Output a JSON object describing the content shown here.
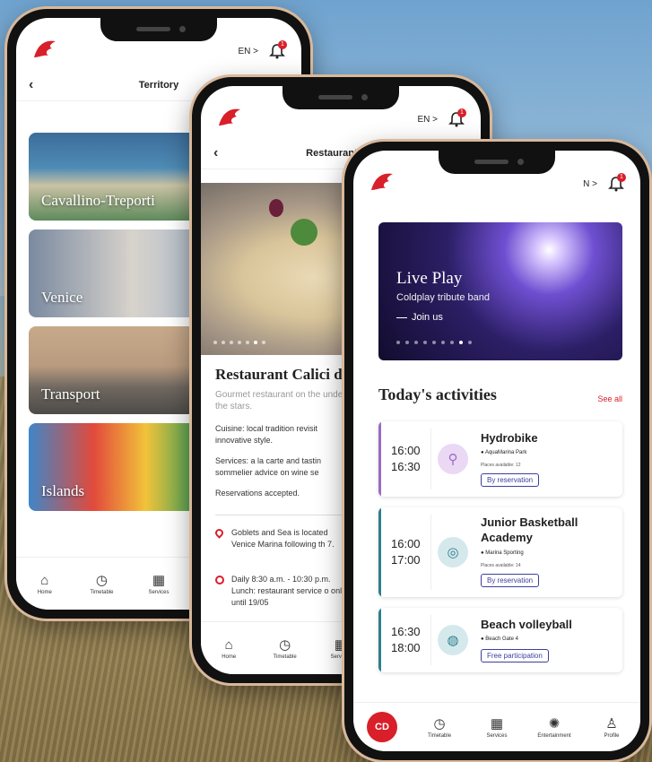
{
  "colors": {
    "brand_red": "#d81f2a",
    "accent_purple": "#9b6bc4",
    "accent_teal": "#2e7f8c",
    "pill_blue": "#3b3f9e"
  },
  "common": {
    "lang": "EN",
    "lang_chevron": ">",
    "notifications_count": "1"
  },
  "phone1": {
    "back": "‹",
    "title": "Territory",
    "tiles": [
      {
        "label": "Cavallino-Treporti"
      },
      {
        "label": "Venice"
      },
      {
        "label": "Transport"
      },
      {
        "label": "Islands"
      }
    ],
    "nav": [
      {
        "label": "Home",
        "icon": "home-icon"
      },
      {
        "label": "Timetable",
        "icon": "clock-icon"
      },
      {
        "label": "Services",
        "icon": "grid-icon"
      }
    ]
  },
  "phone2": {
    "back": "‹",
    "title": "Restaurant Cal",
    "heading": "Restaurant Calici d",
    "subtitle": "Gourmet restaurant on the under the stars.",
    "cuisine": "Cuisine: local tradition revisit innovative style.",
    "services": "Services: a la carte and tastin sommelier advice on wine se",
    "reservations": "Reservations accepted.",
    "location": "Goblets and Sea is located Venice Marina following th 7.",
    "hours": "Daily 8:30 a.m. - 10:30 p.m. Lunch: restaurant service o only, until 19/05",
    "nav": [
      {
        "label": "Home",
        "icon": "home-icon"
      },
      {
        "label": "Timetable",
        "icon": "clock-icon"
      },
      {
        "label": "Services",
        "icon": "grid-icon"
      }
    ]
  },
  "phone3": {
    "lang": "N",
    "banner": {
      "title": "Live Play",
      "subtitle": "Coldplay tribute band",
      "cta": "Join us"
    },
    "section_title": "Today's activities",
    "see_all": "See all",
    "activities": [
      {
        "start": "16:00",
        "end": "16:30",
        "name": "Hydrobike",
        "location": "AquaMarina Park",
        "places": "Places available: 12",
        "tag": "By reservation",
        "icon": "bike-icon"
      },
      {
        "start": "16:00",
        "end": "17:00",
        "name": "Junior Basketball Academy",
        "location": "Marina Sporting",
        "places": "Places available: 14",
        "tag": "By reservation",
        "icon": "basketball-icon"
      },
      {
        "start": "16:30",
        "end": "18:00",
        "name": "Beach volleyball",
        "location": "Beach Gate 4",
        "places": "",
        "tag": "Free participation",
        "icon": "volleyball-icon"
      }
    ],
    "fab_label": "CD",
    "nav": [
      {
        "label": "Timetable",
        "icon": "clock-icon"
      },
      {
        "label": "Services",
        "icon": "grid-icon"
      },
      {
        "label": "Entertainment",
        "icon": "fun-icon"
      },
      {
        "label": "Profile",
        "icon": "profile-icon"
      }
    ]
  }
}
